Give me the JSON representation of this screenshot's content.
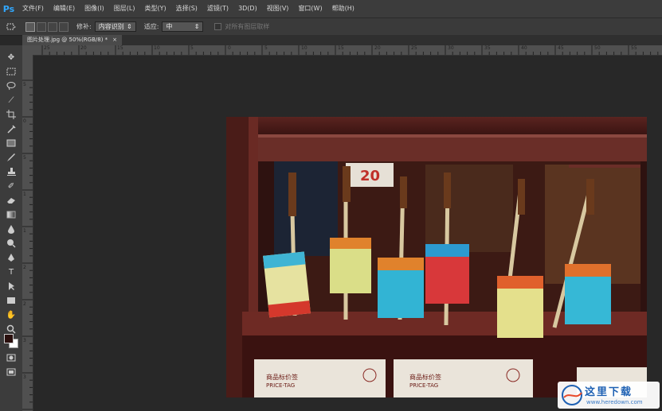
{
  "app": {
    "logo": "Ps"
  },
  "menu": [
    "文件(F)",
    "编辑(E)",
    "图像(I)",
    "图层(L)",
    "类型(Y)",
    "选择(S)",
    "滤镜(T)",
    "3D(D)",
    "视图(V)",
    "窗口(W)",
    "帮助(H)"
  ],
  "options": {
    "tool_icon": "patch-tool-icon",
    "patch_label": "修补:",
    "patch_value": "内容识别",
    "adapt_label": "适应:",
    "adapt_value": "中",
    "sample_all_label": "对所有图层取样"
  },
  "document": {
    "tab_title": "图片处理.jpg @ 50%(RGB/8) *",
    "close": "×"
  },
  "ruler_top": [
    "25",
    "20",
    "15",
    "10",
    "5",
    "0",
    "5",
    "10",
    "15",
    "20",
    "25",
    "30",
    "35",
    "40",
    "45",
    "50",
    "55"
  ],
  "ruler_left": [
    "5",
    "0",
    "5",
    "1",
    "1",
    "2",
    "2",
    "3",
    "3"
  ],
  "photo": {
    "price_tag_number": "20",
    "tag_title": "商品标价签",
    "tag_sub": "PRICE-TAG"
  },
  "watermark": {
    "title": "这里下载",
    "url": "www.heredown.com"
  },
  "colors": {
    "foreground": "#2a0f0d",
    "background": "#ffffff",
    "accent": "#31a8ff"
  }
}
